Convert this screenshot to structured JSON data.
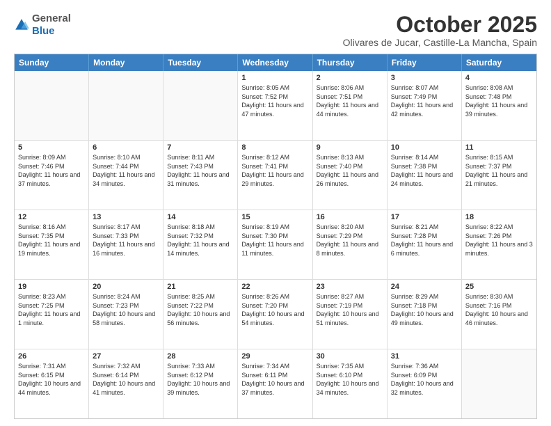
{
  "header": {
    "logo_general": "General",
    "logo_blue": "Blue",
    "month": "October 2025",
    "location": "Olivares de Jucar, Castille-La Mancha, Spain"
  },
  "weekdays": [
    "Sunday",
    "Monday",
    "Tuesday",
    "Wednesday",
    "Thursday",
    "Friday",
    "Saturday"
  ],
  "rows": [
    [
      {
        "day": "",
        "info": ""
      },
      {
        "day": "",
        "info": ""
      },
      {
        "day": "",
        "info": ""
      },
      {
        "day": "1",
        "info": "Sunrise: 8:05 AM\nSunset: 7:52 PM\nDaylight: 11 hours and 47 minutes."
      },
      {
        "day": "2",
        "info": "Sunrise: 8:06 AM\nSunset: 7:51 PM\nDaylight: 11 hours and 44 minutes."
      },
      {
        "day": "3",
        "info": "Sunrise: 8:07 AM\nSunset: 7:49 PM\nDaylight: 11 hours and 42 minutes."
      },
      {
        "day": "4",
        "info": "Sunrise: 8:08 AM\nSunset: 7:48 PM\nDaylight: 11 hours and 39 minutes."
      }
    ],
    [
      {
        "day": "5",
        "info": "Sunrise: 8:09 AM\nSunset: 7:46 PM\nDaylight: 11 hours and 37 minutes."
      },
      {
        "day": "6",
        "info": "Sunrise: 8:10 AM\nSunset: 7:44 PM\nDaylight: 11 hours and 34 minutes."
      },
      {
        "day": "7",
        "info": "Sunrise: 8:11 AM\nSunset: 7:43 PM\nDaylight: 11 hours and 31 minutes."
      },
      {
        "day": "8",
        "info": "Sunrise: 8:12 AM\nSunset: 7:41 PM\nDaylight: 11 hours and 29 minutes."
      },
      {
        "day": "9",
        "info": "Sunrise: 8:13 AM\nSunset: 7:40 PM\nDaylight: 11 hours and 26 minutes."
      },
      {
        "day": "10",
        "info": "Sunrise: 8:14 AM\nSunset: 7:38 PM\nDaylight: 11 hours and 24 minutes."
      },
      {
        "day": "11",
        "info": "Sunrise: 8:15 AM\nSunset: 7:37 PM\nDaylight: 11 hours and 21 minutes."
      }
    ],
    [
      {
        "day": "12",
        "info": "Sunrise: 8:16 AM\nSunset: 7:35 PM\nDaylight: 11 hours and 19 minutes."
      },
      {
        "day": "13",
        "info": "Sunrise: 8:17 AM\nSunset: 7:33 PM\nDaylight: 11 hours and 16 minutes."
      },
      {
        "day": "14",
        "info": "Sunrise: 8:18 AM\nSunset: 7:32 PM\nDaylight: 11 hours and 14 minutes."
      },
      {
        "day": "15",
        "info": "Sunrise: 8:19 AM\nSunset: 7:30 PM\nDaylight: 11 hours and 11 minutes."
      },
      {
        "day": "16",
        "info": "Sunrise: 8:20 AM\nSunset: 7:29 PM\nDaylight: 11 hours and 8 minutes."
      },
      {
        "day": "17",
        "info": "Sunrise: 8:21 AM\nSunset: 7:28 PM\nDaylight: 11 hours and 6 minutes."
      },
      {
        "day": "18",
        "info": "Sunrise: 8:22 AM\nSunset: 7:26 PM\nDaylight: 11 hours and 3 minutes."
      }
    ],
    [
      {
        "day": "19",
        "info": "Sunrise: 8:23 AM\nSunset: 7:25 PM\nDaylight: 11 hours and 1 minute."
      },
      {
        "day": "20",
        "info": "Sunrise: 8:24 AM\nSunset: 7:23 PM\nDaylight: 10 hours and 58 minutes."
      },
      {
        "day": "21",
        "info": "Sunrise: 8:25 AM\nSunset: 7:22 PM\nDaylight: 10 hours and 56 minutes."
      },
      {
        "day": "22",
        "info": "Sunrise: 8:26 AM\nSunset: 7:20 PM\nDaylight: 10 hours and 54 minutes."
      },
      {
        "day": "23",
        "info": "Sunrise: 8:27 AM\nSunset: 7:19 PM\nDaylight: 10 hours and 51 minutes."
      },
      {
        "day": "24",
        "info": "Sunrise: 8:29 AM\nSunset: 7:18 PM\nDaylight: 10 hours and 49 minutes."
      },
      {
        "day": "25",
        "info": "Sunrise: 8:30 AM\nSunset: 7:16 PM\nDaylight: 10 hours and 46 minutes."
      }
    ],
    [
      {
        "day": "26",
        "info": "Sunrise: 7:31 AM\nSunset: 6:15 PM\nDaylight: 10 hours and 44 minutes."
      },
      {
        "day": "27",
        "info": "Sunrise: 7:32 AM\nSunset: 6:14 PM\nDaylight: 10 hours and 41 minutes."
      },
      {
        "day": "28",
        "info": "Sunrise: 7:33 AM\nSunset: 6:12 PM\nDaylight: 10 hours and 39 minutes."
      },
      {
        "day": "29",
        "info": "Sunrise: 7:34 AM\nSunset: 6:11 PM\nDaylight: 10 hours and 37 minutes."
      },
      {
        "day": "30",
        "info": "Sunrise: 7:35 AM\nSunset: 6:10 PM\nDaylight: 10 hours and 34 minutes."
      },
      {
        "day": "31",
        "info": "Sunrise: 7:36 AM\nSunset: 6:09 PM\nDaylight: 10 hours and 32 minutes."
      },
      {
        "day": "",
        "info": ""
      }
    ]
  ]
}
